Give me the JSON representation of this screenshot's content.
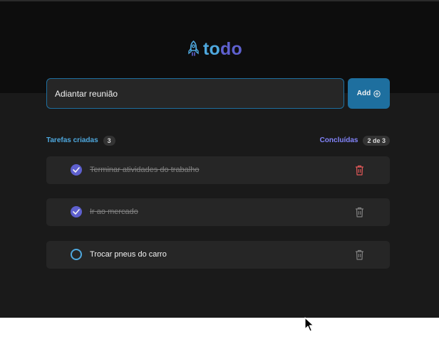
{
  "brand": {
    "prefix": "to",
    "suffix": "do",
    "icon": "rocket-icon"
  },
  "new_task": {
    "value": "Adiantar reunião",
    "add_label": "Add",
    "add_icon": "plus-circle-icon"
  },
  "info": {
    "created_label": "Tarefas criadas",
    "created_count": "3",
    "done_label": "Concluídas",
    "done_count": "2 de 3"
  },
  "tasks": [
    {
      "text": "Terminar atividades do trabalho",
      "done": true
    },
    {
      "text": "Ir ao mercado",
      "done": true
    },
    {
      "text": "Trocar pneus do carro",
      "done": false
    }
  ],
  "colors": {
    "blue": "#4ea8de",
    "purple": "#5e60ce",
    "purple_light": "#8284fa",
    "dark_blue": "#1e6f9f",
    "danger": "#e25858"
  }
}
